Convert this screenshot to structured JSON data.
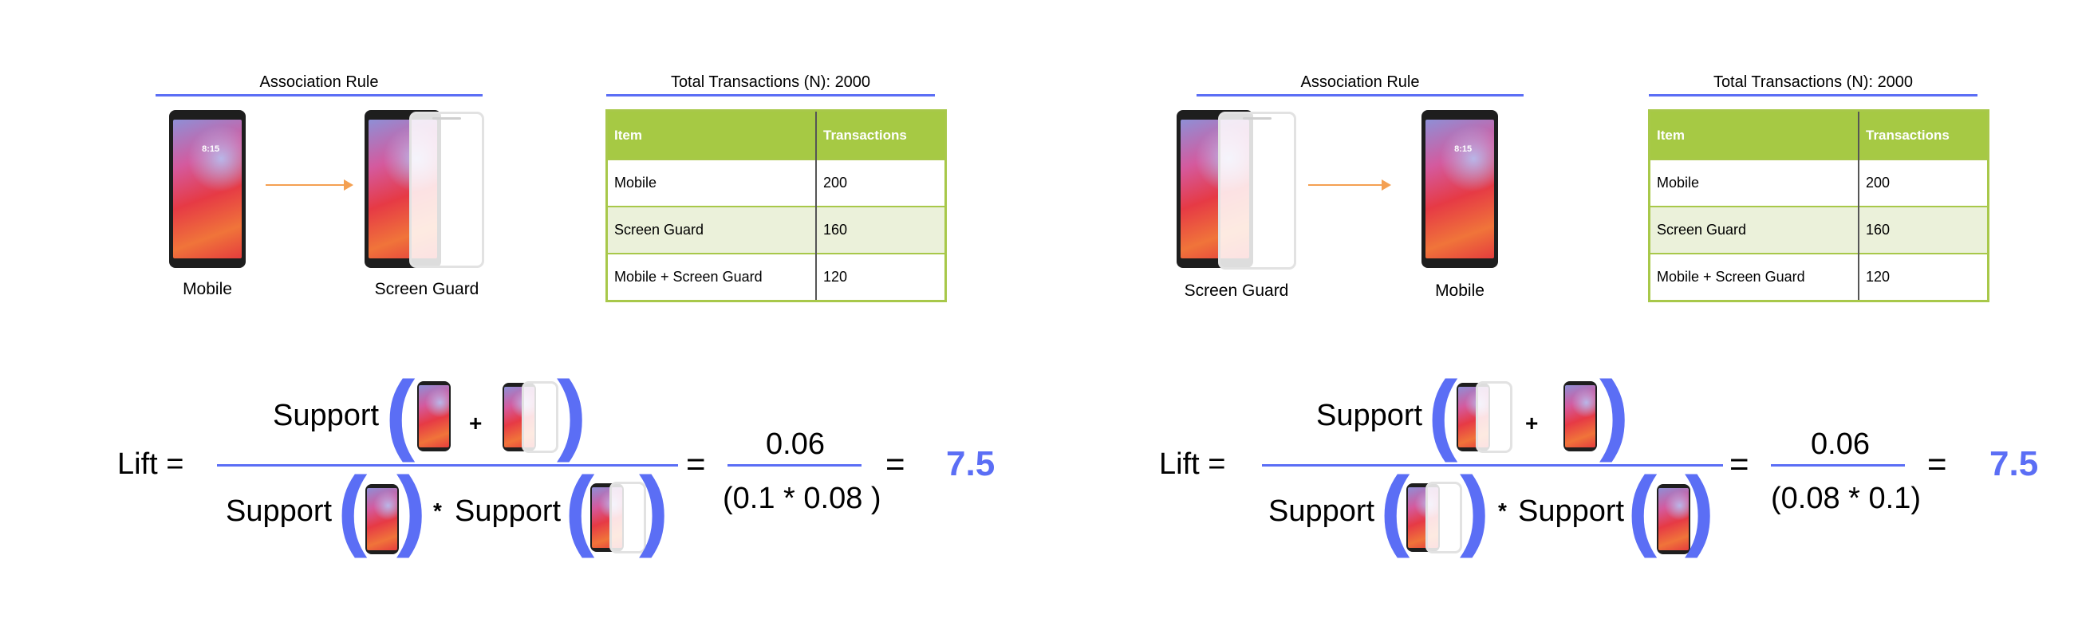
{
  "panels": [
    {
      "rule_header": "Association Rule",
      "antecedent_label": "Mobile",
      "consequent_label": "Screen Guard",
      "table_title": "Total Transactions (N): 2000",
      "table": {
        "headers": [
          "Item",
          "Transactions"
        ],
        "rows": [
          [
            "Mobile",
            "200"
          ],
          [
            "Screen Guard",
            "160"
          ],
          [
            "Mobile + Screen Guard",
            "120"
          ]
        ]
      },
      "formula": {
        "lhs": "Lift =",
        "support_word": "Support",
        "plus": "+",
        "times": "*",
        "equals": "=",
        "numerator_value": "0.06",
        "denominator_value": "(0.1 * 0.08 )",
        "result": "7.5"
      }
    },
    {
      "rule_header": "Association Rule",
      "antecedent_label": "Screen Guard",
      "consequent_label": "Mobile",
      "table_title": "Total Transactions (N): 2000",
      "table": {
        "headers": [
          "Item",
          "Transactions"
        ],
        "rows": [
          [
            "Mobile",
            "200"
          ],
          [
            "Screen Guard",
            "160"
          ],
          [
            "Mobile + Screen Guard",
            "120"
          ]
        ]
      },
      "formula": {
        "lhs": "Lift =",
        "support_word": "Support",
        "plus": "+",
        "times": "*",
        "equals": "=",
        "numerator_value": "0.06",
        "denominator_value": "(0.08 * 0.1)",
        "result": "7.5"
      }
    }
  ],
  "colors": {
    "accent_blue": "#5b6ef5",
    "table_header_green": "#a6c944",
    "table_alt_row": "#ebf1da",
    "arrow_orange": "#f4a052"
  },
  "icons": [
    "mobile-phone-icon",
    "screen-guard-icon",
    "arrow-right-icon"
  ]
}
